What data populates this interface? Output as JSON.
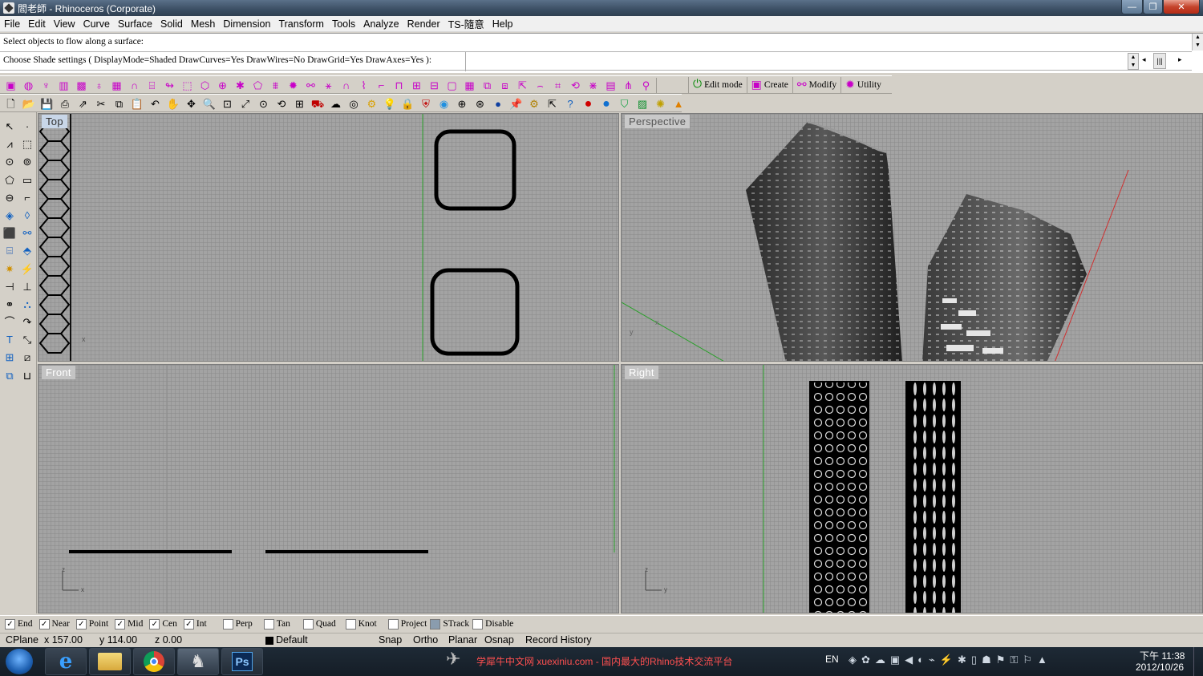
{
  "window": {
    "title": "閻老師 - Rhinoceros (Corporate)",
    "controls": {
      "minimize": "—",
      "maximize": "❐",
      "close": "✕"
    }
  },
  "menu": [
    "File",
    "Edit",
    "View",
    "Curve",
    "Surface",
    "Solid",
    "Mesh",
    "Dimension",
    "Transform",
    "Tools",
    "Analyze",
    "Render",
    "TS-隨意",
    "Help"
  ],
  "command": {
    "history_line": "Select objects to flow along a surface:",
    "prompt": "Choose Shade settings ( DisplayMode=Shaded  DrawCurves=Yes  DrawWires=No  DrawGrid=Yes  DrawAxes=Yes ):"
  },
  "toolbar_tabs": [
    {
      "label": "Edit mode",
      "icon": "power-icon"
    },
    {
      "label": "Create",
      "icon": "cube-icon"
    },
    {
      "label": "Modify",
      "icon": "modify-icon"
    },
    {
      "label": "Utility",
      "icon": "gears-icon"
    }
  ],
  "viewports": {
    "top": "Top",
    "perspective": "Perspective",
    "front": "Front",
    "right": "Right",
    "axis_labels": {
      "x": "x",
      "y": "y",
      "z": "z"
    }
  },
  "osnaps": [
    {
      "label": "End",
      "checked": true
    },
    {
      "label": "Near",
      "checked": true
    },
    {
      "label": "Point",
      "checked": true
    },
    {
      "label": "Mid",
      "checked": true
    },
    {
      "label": "Cen",
      "checked": true
    },
    {
      "label": "Int",
      "checked": true
    },
    {
      "label": "Perp",
      "checked": false
    },
    {
      "label": "Tan",
      "checked": false
    },
    {
      "label": "Quad",
      "checked": false
    },
    {
      "label": "Knot",
      "checked": false
    },
    {
      "label": "Project",
      "checked": false
    },
    {
      "label": "STrack",
      "checked": false
    },
    {
      "label": "Disable",
      "checked": false
    }
  ],
  "status": {
    "cplane": "CPlane",
    "x": "x 157.00",
    "y": "y 114.00",
    "z": "z 0.00",
    "layer": "Default",
    "snap": "Snap",
    "ortho": "Ortho",
    "planar": "Planar",
    "osnap": "Osnap",
    "record_history": "Record History"
  },
  "taskbar": {
    "watermark": "学犀牛中文网 xuexiniu.com  - 国内最大的Rhino技术交流平台",
    "lang": "EN",
    "time": "下午 11:38",
    "date": "2012/10/26",
    "ps_label": "Ps"
  },
  "colors": {
    "accent_magenta": "#c800c8",
    "viewport_bg": "#a3a3a3",
    "active_tab": "#c8d6e8"
  }
}
